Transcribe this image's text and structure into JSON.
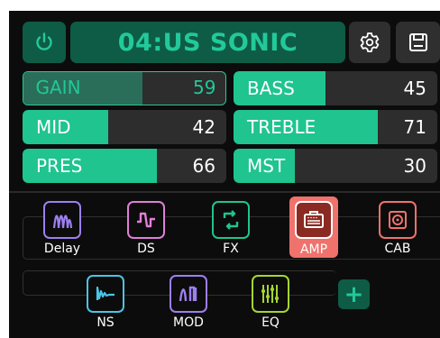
{
  "header": {
    "preset_name": "04:US SONIC",
    "icons": {
      "power": "power-icon",
      "settings": "gear-icon",
      "save": "floppy-disk-icon"
    }
  },
  "params": [
    {
      "label": "GAIN",
      "value": "59",
      "level": 0.59,
      "selected": true
    },
    {
      "label": "BASS",
      "value": "45",
      "level": 0.45
    },
    {
      "label": "MID",
      "value": "42",
      "level": 0.42
    },
    {
      "label": "TREBLE",
      "value": "71",
      "level": 0.71
    },
    {
      "label": "PRES",
      "value": "66",
      "level": 0.66
    },
    {
      "label": "MST",
      "value": "30",
      "level": 0.3
    }
  ],
  "modules": [
    {
      "label": "Delay",
      "icon": "delay-wave-icon",
      "color": "#9d7ff0"
    },
    {
      "label": "DS",
      "icon": "distortion-wave-icon",
      "color": "#e07fd8"
    },
    {
      "label": "FX",
      "icon": "loop-arrows-icon",
      "color": "#1fc48f"
    },
    {
      "label": "AMP",
      "icon": "amplifier-icon",
      "color": "#f0726c",
      "active": true
    },
    {
      "label": "CAB",
      "icon": "speaker-cabinet-icon",
      "color": "#f0726c"
    },
    {
      "label": "NS",
      "icon": "noise-suppressor-icon",
      "color": "#4cc4e6"
    },
    {
      "label": "MOD",
      "icon": "modulation-wave-icon",
      "color": "#9d7ff0"
    },
    {
      "label": "EQ",
      "icon": "equalizer-sliders-icon",
      "color": "#a5d62e"
    }
  ],
  "add_button": {
    "label": "+"
  },
  "colors": {
    "accent": "#1fc48f",
    "accent_dark": "#0e5c45",
    "active_module": "#f0726c"
  }
}
